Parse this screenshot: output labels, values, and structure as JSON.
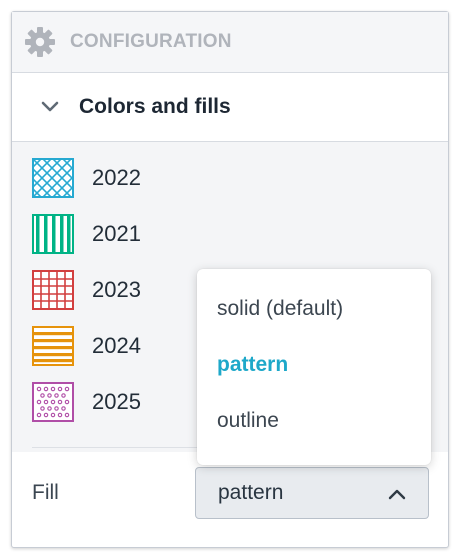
{
  "header": {
    "title": "CONFIGURATION",
    "icon": "gear-icon"
  },
  "section": {
    "title": "Colors and fills",
    "icon": "chevron-down-icon"
  },
  "items": [
    {
      "label": "2022",
      "color": "#26a9d1",
      "pattern": "diagonal-crosshatch"
    },
    {
      "label": "2021",
      "color": "#00b386",
      "pattern": "vertical-stripes"
    },
    {
      "label": "2023",
      "color": "#d23f3f",
      "pattern": "grid"
    },
    {
      "label": "2024",
      "color": "#e6930b",
      "pattern": "horizontal-stripes"
    },
    {
      "label": "2025",
      "color": "#b04ea7",
      "pattern": "dots"
    }
  ],
  "fill": {
    "label": "Fill",
    "selected": "pattern",
    "options": [
      "solid (default)",
      "pattern",
      "outline"
    ]
  },
  "colors": {
    "accent": "#1ea8c9",
    "text": "#222d38",
    "header_text": "#b0b4bb"
  }
}
